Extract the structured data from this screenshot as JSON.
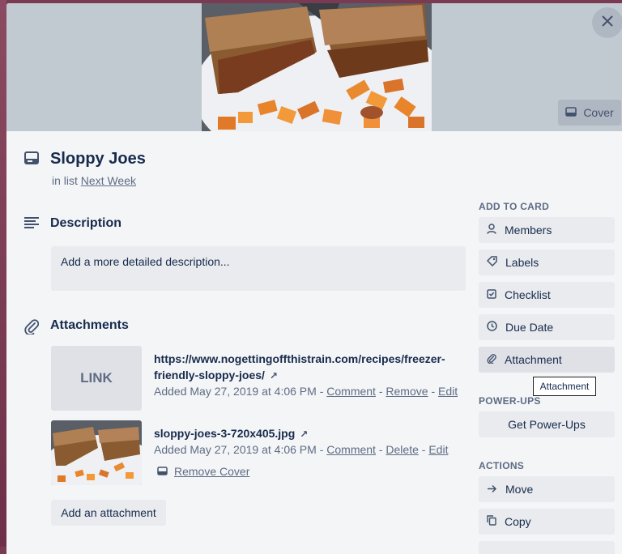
{
  "card": {
    "title": "Sloppy Joes",
    "in_list_prefix": "in list",
    "list_name": "Next Week",
    "cover_button_label": "Cover"
  },
  "description": {
    "heading": "Description",
    "placeholder": "Add a more detailed description..."
  },
  "attachments": {
    "heading": "Attachments",
    "items": [
      {
        "thumb_label": "LINK",
        "name_line1": "https://www.nogettingoffthistrain.com/recipes/freezer-",
        "name_line2": "friendly-sloppy-joes/",
        "added": "Added May 27, 2019 at 4:06 PM",
        "sep": "-",
        "action1": "Comment",
        "action2": "Remove",
        "action3": "Edit"
      },
      {
        "name_line1": "sloppy-joes-3-720x405.jpg",
        "added": "Added May 27, 2019 at 4:06 PM",
        "sep": "-",
        "action1": "Comment",
        "action2": "Delete",
        "action3": "Edit",
        "remove_cover_label": "Remove Cover"
      }
    ],
    "add_button_label": "Add an attachment"
  },
  "sidebar": {
    "add_to_card_heading": "ADD TO CARD",
    "add_to_card": [
      {
        "label": "Members",
        "icon": "person-icon"
      },
      {
        "label": "Labels",
        "icon": "tag-icon"
      },
      {
        "label": "Checklist",
        "icon": "checkbox-icon"
      },
      {
        "label": "Due Date",
        "icon": "clock-icon"
      },
      {
        "label": "Attachment",
        "icon": "paperclip-icon"
      }
    ],
    "tooltip_text": "Attachment",
    "power_ups_heading": "POWER-UPS",
    "power_ups_button_label": "Get Power-Ups",
    "actions_heading": "ACTIONS",
    "actions": [
      {
        "label": "Move",
        "icon": "arrow-right-icon"
      },
      {
        "label": "Copy",
        "icon": "copy-icon"
      }
    ]
  },
  "colors": {
    "modal_bg": "#f4f5f7",
    "button_bg": "#e9ebee",
    "text": "#172b4d",
    "muted_text": "#5e6c84",
    "cover_bg": "#c2cad1",
    "backdrop": "#7a3a52"
  }
}
